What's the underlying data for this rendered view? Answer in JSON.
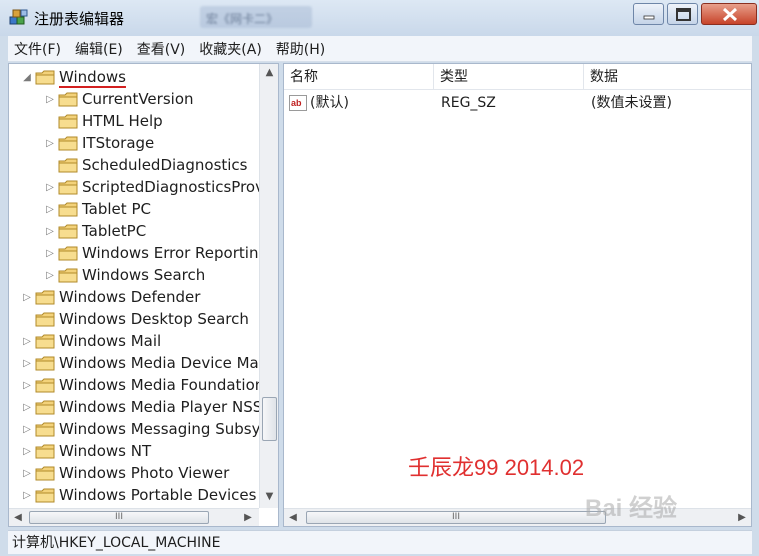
{
  "window": {
    "title": "注册表编辑器",
    "blurred_tab": "宏《网卡二》"
  },
  "menu": [
    "文件(F)",
    "编辑(E)",
    "查看(V)",
    "收藏夹(A)",
    "帮助(H)"
  ],
  "tree": {
    "items": [
      {
        "label": "Windows",
        "level": 0,
        "expander": "open",
        "selected": true
      },
      {
        "label": "CurrentVersion",
        "level": 1,
        "expander": "closed"
      },
      {
        "label": "HTML Help",
        "level": 1,
        "expander": "none"
      },
      {
        "label": "ITStorage",
        "level": 1,
        "expander": "closed"
      },
      {
        "label": "ScheduledDiagnostics",
        "level": 1,
        "expander": "none"
      },
      {
        "label": "ScriptedDiagnosticsProv",
        "level": 1,
        "expander": "closed"
      },
      {
        "label": "Tablet PC",
        "level": 1,
        "expander": "closed"
      },
      {
        "label": "TabletPC",
        "level": 1,
        "expander": "closed"
      },
      {
        "label": "Windows Error Reporting",
        "level": 1,
        "expander": "closed"
      },
      {
        "label": "Windows Search",
        "level": 1,
        "expander": "closed"
      },
      {
        "label": "Windows Defender",
        "level": 0,
        "expander": "closed"
      },
      {
        "label": "Windows Desktop Search",
        "level": 0,
        "expander": "none"
      },
      {
        "label": "Windows Mail",
        "level": 0,
        "expander": "closed"
      },
      {
        "label": "Windows Media Device Ma",
        "level": 0,
        "expander": "closed"
      },
      {
        "label": "Windows Media Foundation",
        "level": 0,
        "expander": "closed"
      },
      {
        "label": "Windows Media Player NSS",
        "level": 0,
        "expander": "closed"
      },
      {
        "label": "Windows Messaging Subsys",
        "level": 0,
        "expander": "closed"
      },
      {
        "label": "Windows NT",
        "level": 0,
        "expander": "closed"
      },
      {
        "label": "Windows Photo Viewer",
        "level": 0,
        "expander": "closed"
      },
      {
        "label": "Windows Portable Devices",
        "level": 0,
        "expander": "closed"
      }
    ]
  },
  "list": {
    "columns": [
      "名称",
      "类型",
      "数据"
    ],
    "rows": [
      {
        "name": "(默认)",
        "type": "REG_SZ",
        "data": "(数值未设置)",
        "icon": "string-value-icon"
      }
    ]
  },
  "overlay_text": "壬辰龙99 2014.02",
  "watermark": "Bai 经验",
  "status": "计算机\\HKEY_LOCAL_MACHINE"
}
